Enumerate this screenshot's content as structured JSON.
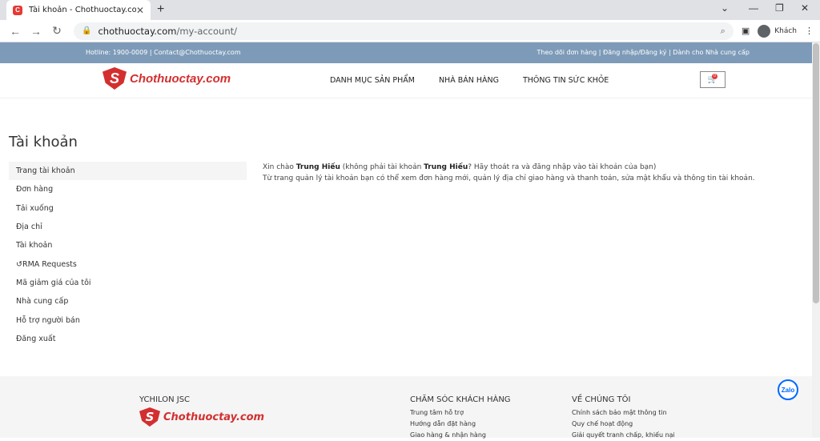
{
  "browser": {
    "tab_title": "Tài khoản - Chothuoctay.com",
    "url_host": "chothuoctay.com",
    "url_path": "/my-account/",
    "profile_label": "Khách"
  },
  "topbar": {
    "left": "Hotline: 1900-0009 | Contact@Chothuoctay.com",
    "right": "Theo dõi đơn hàng  |  Đăng nhập/Đăng ký  |  Dành cho Nhà cung cấp"
  },
  "header": {
    "logo_text": "Chothuoctay.com",
    "nav": [
      "DANH MỤC SẢN PHẨM",
      "NHÀ BÁN HÀNG",
      "THÔNG TIN SỨC KHỎE"
    ],
    "cart_count": "0"
  },
  "page": {
    "title": "Tài khoản",
    "nav_items": [
      "Trang tài khoản",
      "Đơn hàng",
      "Tải xuống",
      "Địa chỉ",
      "Tài khoản",
      "RMA Requests",
      "Mã giảm giá của tôi",
      "Nhà cung cấp",
      "Hỗ trợ người bán",
      "Đăng xuất"
    ],
    "greeting_prefix": "Xin chào ",
    "user_name": "Trung Hiếu",
    "greeting_mid": " (không phải tài khoản ",
    "greeting_suffix": "? Hãy thoát ra và đăng nhập vào tài khoản của bạn)",
    "description": "Từ trang quản lý tài khoản bạn có thể xem đơn hàng mới, quản lý địa chỉ giao hàng và thanh toán, sửa mật khẩu và thông tin tài khoản."
  },
  "footer": {
    "company": "YCHILON JSC",
    "col2_title": "CHĂM SÓC KHÁCH HÀNG",
    "col2_links": [
      "Trung tâm hỗ trợ",
      "Hướng dẫn đặt hàng",
      "Giao hàng & nhận hàng"
    ],
    "col3_title": "VỀ CHÚNG TÔI",
    "col3_links": [
      "Chính sách bảo mật thông tin",
      "Quy chế hoạt động",
      "Giải quyết tranh chấp, khiếu nại"
    ]
  },
  "zalo_label": "Zalo"
}
